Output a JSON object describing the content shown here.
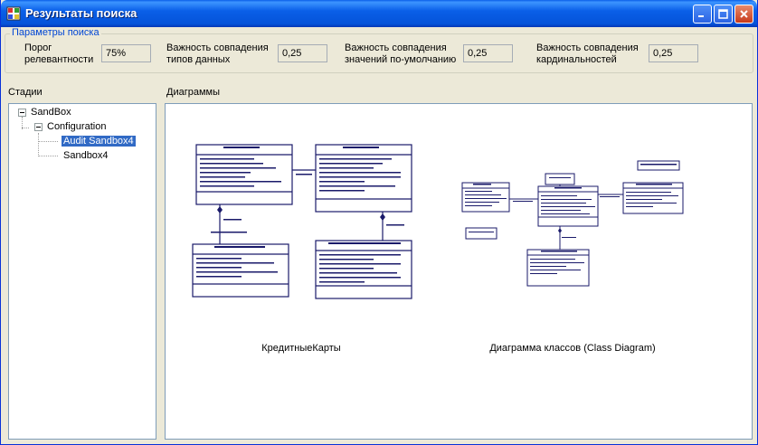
{
  "window": {
    "title": "Результаты поиска"
  },
  "params": {
    "group_label": "Параметры поиска",
    "relevance_label_1": "Порог",
    "relevance_label_2": "релевантности",
    "relevance_value": "75%",
    "types_label_1": "Важность совпадения",
    "types_label_2": "типов данных",
    "types_value": "0,25",
    "defaults_label_1": "Важность совпадения",
    "defaults_label_2": "значений по-умолчанию",
    "defaults_value": "0,25",
    "card_label_1": "Важность совпадения",
    "card_label_2": "кардинальностей",
    "card_value": "0,25"
  },
  "stages": {
    "label": "Стадии",
    "root": "SandBox",
    "child": "Configuration",
    "items": [
      "Audit Sandbox4",
      "Sandbox4"
    ]
  },
  "diagrams": {
    "label": "Диаграммы",
    "items": [
      {
        "caption": "КредитныеКарты"
      },
      {
        "caption": "Диаграмма классов (Class Diagram)"
      }
    ]
  }
}
